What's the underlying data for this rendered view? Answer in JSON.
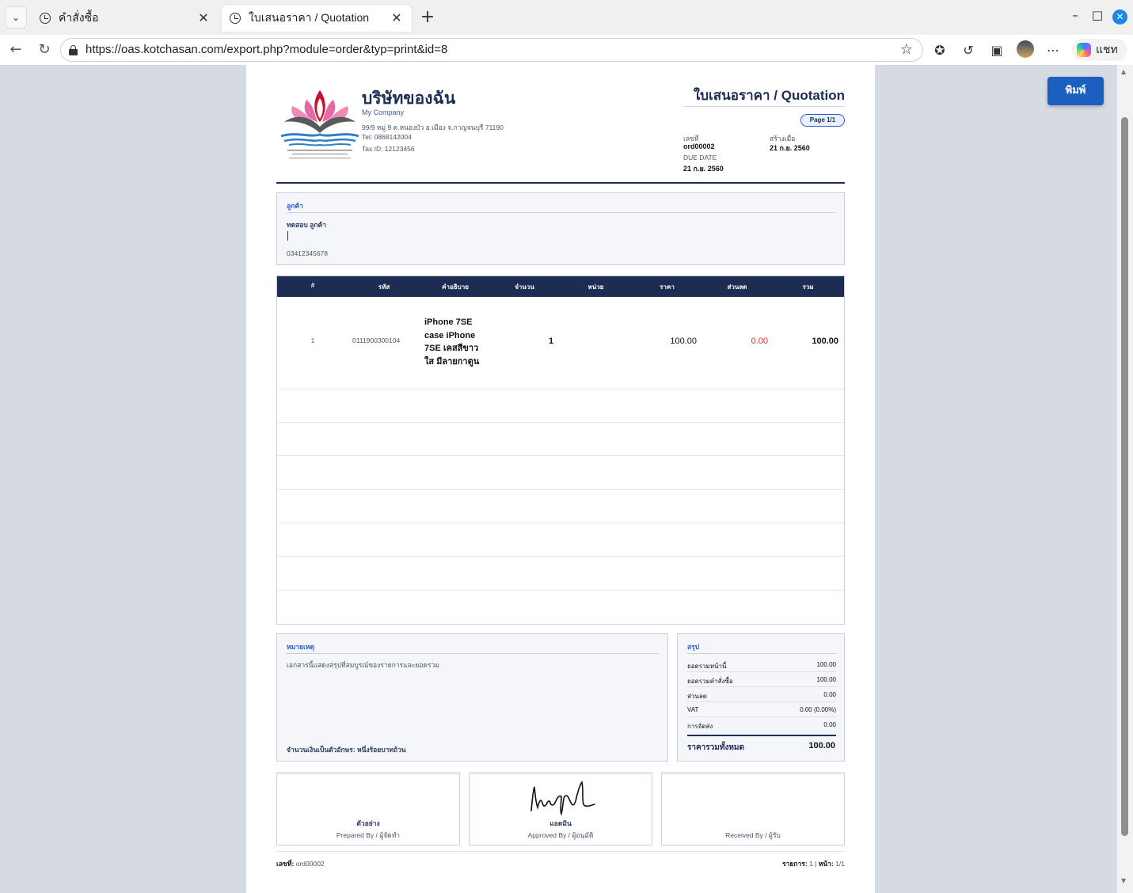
{
  "browser": {
    "tabs": [
      {
        "label": "คำสั่งซื้อ"
      },
      {
        "label": "ใบเสนอราคา / Quotation"
      }
    ],
    "url": "https://oas.kotchasan.com/export.php?module=order&typ=print&id=8",
    "chat_label": "แชท"
  },
  "print_button": "พิมพ์",
  "company": {
    "name": "บริษัทของฉัน",
    "name_en": "My Company",
    "address": "99/9 หมู่ 9 ต.หนองบัว อ.เมือง จ.กาญจนบุรี 71190",
    "tel": "Tel: 0868142004",
    "tax_id": "Tax ID: 12123456"
  },
  "document": {
    "title": "ใบเสนอราคา / Quotation",
    "page": "Page 1/1",
    "number_label": "เลขที่",
    "number": "ord00002",
    "created_label": "สร้างเมื่อ",
    "created": "21 ก.ย. 2560",
    "due_label": "DUE DATE",
    "due": "21 ก.ย. 2560"
  },
  "customer": {
    "section_title": "ลูกค้า",
    "name": "ทดสอบ ลูกค้า",
    "phone": "03412345678"
  },
  "items": {
    "columns": [
      "#",
      "รหัส",
      "คำอธิบาย",
      "จำนวน",
      "หน่วย",
      "ราคา",
      "ส่วนลด",
      "รวม"
    ],
    "rows": [
      {
        "no": "1",
        "code": "0111900300104",
        "description": "iPhone 7SE case iPhone 7SE เคสสีขาวใส มีลายกาตูน",
        "qty": "1",
        "unit": "",
        "price": "100.00",
        "discount": "0.00",
        "total": "100.00"
      }
    ],
    "discount_color": "#d32f2f"
  },
  "notes": {
    "section_title": "หมายเหตุ",
    "text": "เอกสารนี้แสดงสรุปที่สมบูรณ์ของรายการและยอดรวม",
    "amount_words": "จำนวนเงินเป็นตัวอักษร: หนึ่งร้อยบาทถ้วน"
  },
  "summary": {
    "section_title": "สรุป",
    "rows": [
      {
        "label": "ยอดรวมหน้านี้",
        "value": "100.00"
      },
      {
        "label": "ยอดรวมคำสั่งซื้อ",
        "value": "100.00"
      },
      {
        "label": "ส่วนลด",
        "value": "0.00"
      },
      {
        "label": "VAT",
        "value": "0.00 (0.00%)"
      },
      {
        "label": "การจัดส่ง",
        "value": "0.00"
      }
    ],
    "total_label": "ราคารวมทั้งหมด",
    "total_value": "100.00"
  },
  "signatures": [
    {
      "name": "ตัวอย่าง",
      "role": "Prepared By / ผู้จัดทำ"
    },
    {
      "name": "แอดมิน",
      "role": "Approved By / ผู้อนุมัติ"
    },
    {
      "name": "",
      "role": "Received By / ผู้รับ"
    }
  ],
  "footer": {
    "number_label": "เลขที่:",
    "number": "ord00002",
    "items_label": "รายการ:",
    "items_count": "1",
    "separator": "|",
    "page_label": "หน้า:",
    "page": "1/1"
  },
  "colors": {
    "primary": "#1d2c52",
    "accent": "#2a5bd7",
    "print_button": "#1b5fc1"
  }
}
